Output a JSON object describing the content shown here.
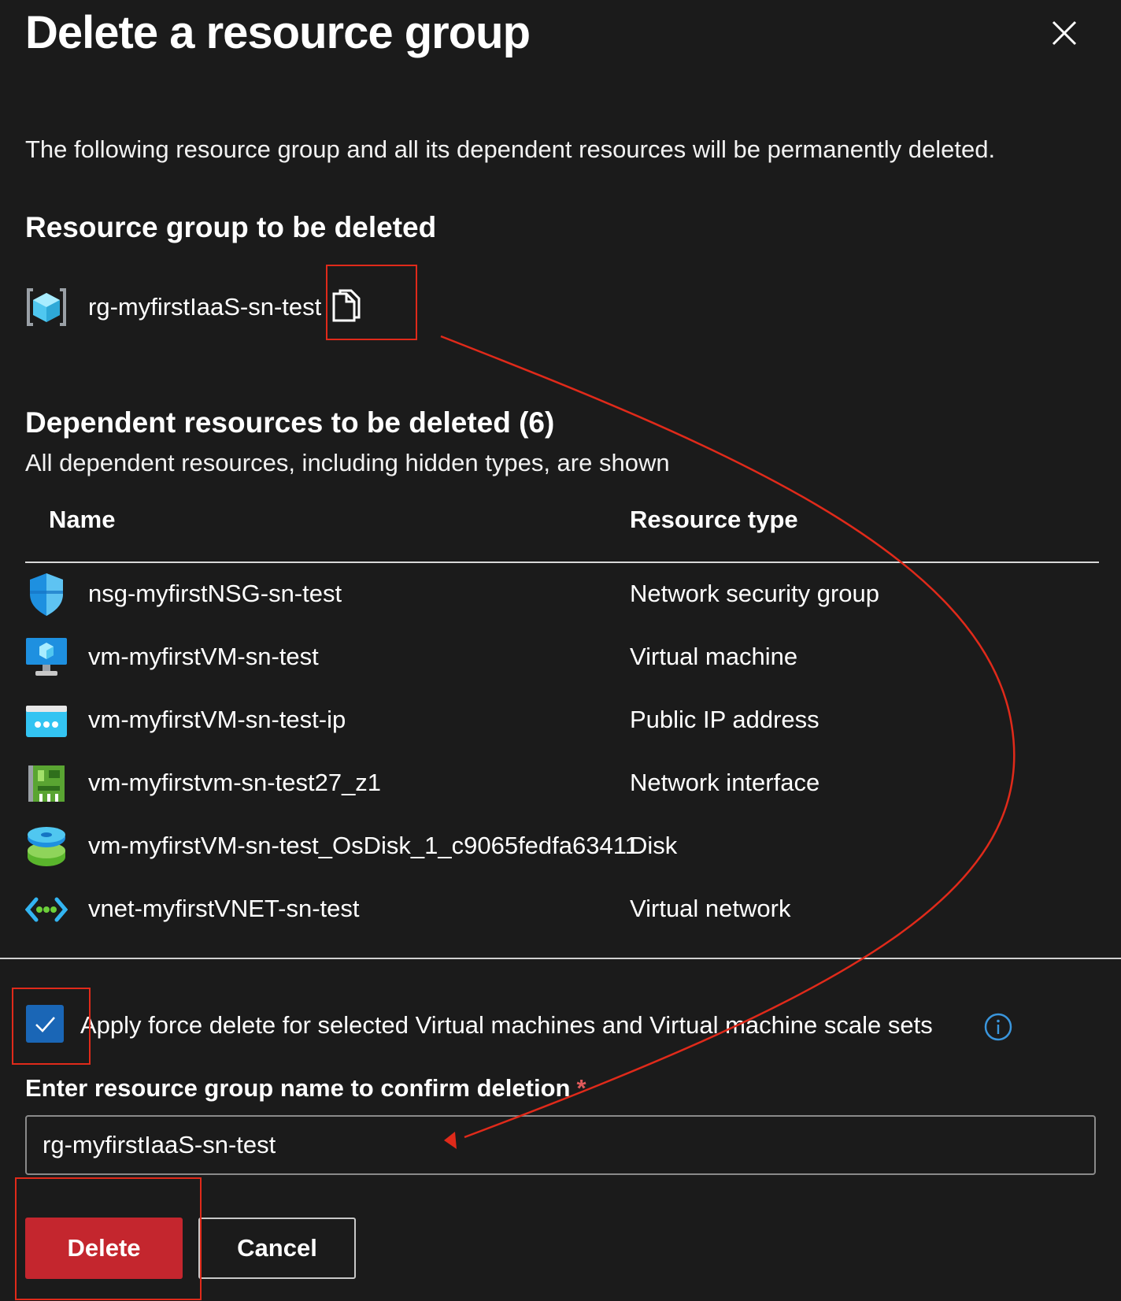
{
  "dialog": {
    "title": "Delete a resource group",
    "description": "The following resource group and all its dependent resources will be permanently deleted."
  },
  "resource_group": {
    "heading": "Resource group to be deleted",
    "name": "rg-myfirstIaaS-sn-test",
    "icon": "resource-group-icon"
  },
  "dependent": {
    "heading": "Dependent resources to be deleted (6)",
    "subheading": "All dependent resources, including hidden types, are shown",
    "columns": {
      "name": "Name",
      "type": "Resource type"
    },
    "rows": [
      {
        "name": "nsg-myfirstNSG-sn-test",
        "type": "Network security group",
        "icon": "network-security-group-icon"
      },
      {
        "name": "vm-myfirstVM-sn-test",
        "type": "Virtual machine",
        "icon": "virtual-machine-icon"
      },
      {
        "name": "vm-myfirstVM-sn-test-ip",
        "type": "Public IP address",
        "icon": "public-ip-icon"
      },
      {
        "name": "vm-myfirstvm-sn-test27_z1",
        "type": "Network interface",
        "icon": "network-interface-icon"
      },
      {
        "name": "vm-myfirstVM-sn-test_OsDisk_1_c9065fedfa63411",
        "type": "Disk",
        "icon": "disk-icon"
      },
      {
        "name": "vnet-myfirstVNET-sn-test",
        "type": "Virtual network",
        "icon": "virtual-network-icon"
      }
    ]
  },
  "force_delete": {
    "label": "Apply force delete for selected Virtual machines and Virtual machine scale sets",
    "checked": true
  },
  "confirm": {
    "label": "Enter resource group name to confirm deletion",
    "required_mark": "*",
    "value": "rg-myfirstIaaS-sn-test"
  },
  "buttons": {
    "delete": "Delete",
    "cancel": "Cancel"
  },
  "colors": {
    "background": "#1b1b1b",
    "delete_button": "#c4262e",
    "checkbox": "#1a66b6",
    "annotation": "#e02a1a"
  }
}
